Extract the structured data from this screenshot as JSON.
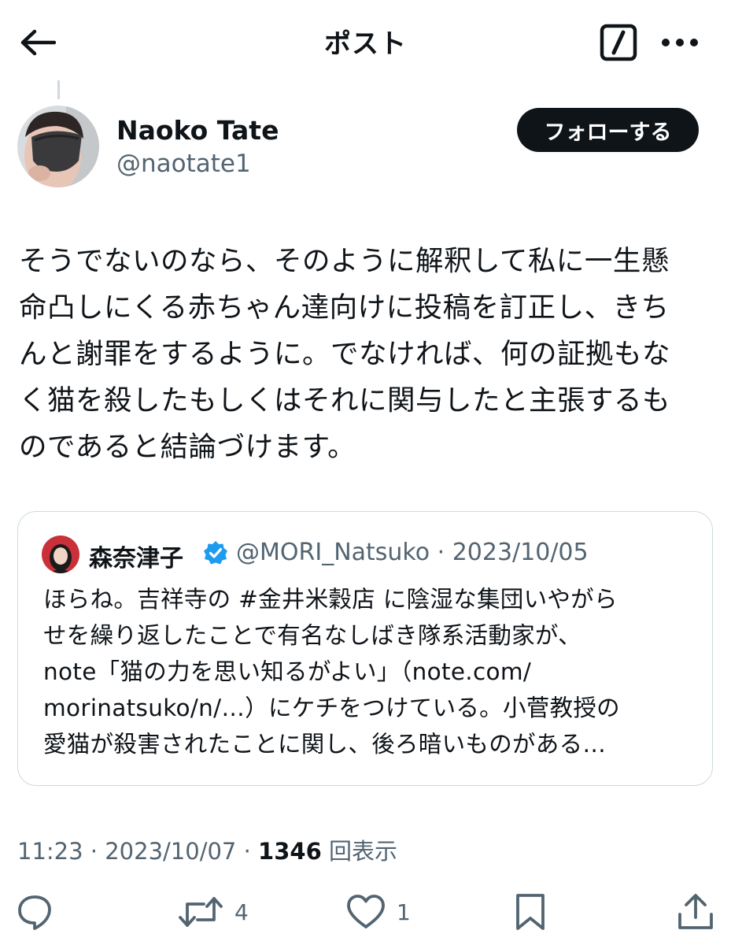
{
  "header": {
    "title": "ポスト"
  },
  "author": {
    "display_name": "Naoko Tate",
    "handle": "@naotate1",
    "follow_label": "フォローする"
  },
  "tweet": {
    "lines": [
      "そうでないのなら、そのように解釈して私に一生懸",
      "命凸しにくる赤ちゃん達向けに投稿を訂正し、きち",
      "んと謝罪をするように。でなければ、何の証拠もな",
      "く猫を殺したもしくはそれに関与したと主張するも",
      "のであると結論づけます。"
    ]
  },
  "quote": {
    "name": "森奈津子",
    "handle_date": "@MORI_Natsuko · 2023/10/05",
    "lines": [
      "ほらね。吉祥寺の #金井米穀店 に陰湿な集団いやがら",
      "せを繰り返したことで有名なしばき隊系活動家が、",
      "note「猫の力を思い知るがよい」（note.com/",
      "morinatsuko/n/…）にケチをつけている。小菅教授の",
      "愛猫が殺害されたことに関し、後ろ暗いものがある…"
    ]
  },
  "meta": {
    "time_date": "11:23 · 2023/10/07 · ",
    "views": "1346",
    "views_label": " 回表示"
  },
  "actions": {
    "reply": "",
    "retweet": "4",
    "like": "1"
  },
  "icons": {
    "back": "arrow-left-icon",
    "grok": "grok-icon",
    "more": "more-icon",
    "verified": "verified-badge-icon",
    "reply": "reply-icon",
    "retweet": "retweet-icon",
    "like": "heart-icon",
    "bookmark": "bookmark-icon",
    "share": "share-icon"
  },
  "colors": {
    "text": "#0f1419",
    "secondary": "#536471",
    "verified": "#1d9bf0",
    "border": "#cfd9de"
  }
}
